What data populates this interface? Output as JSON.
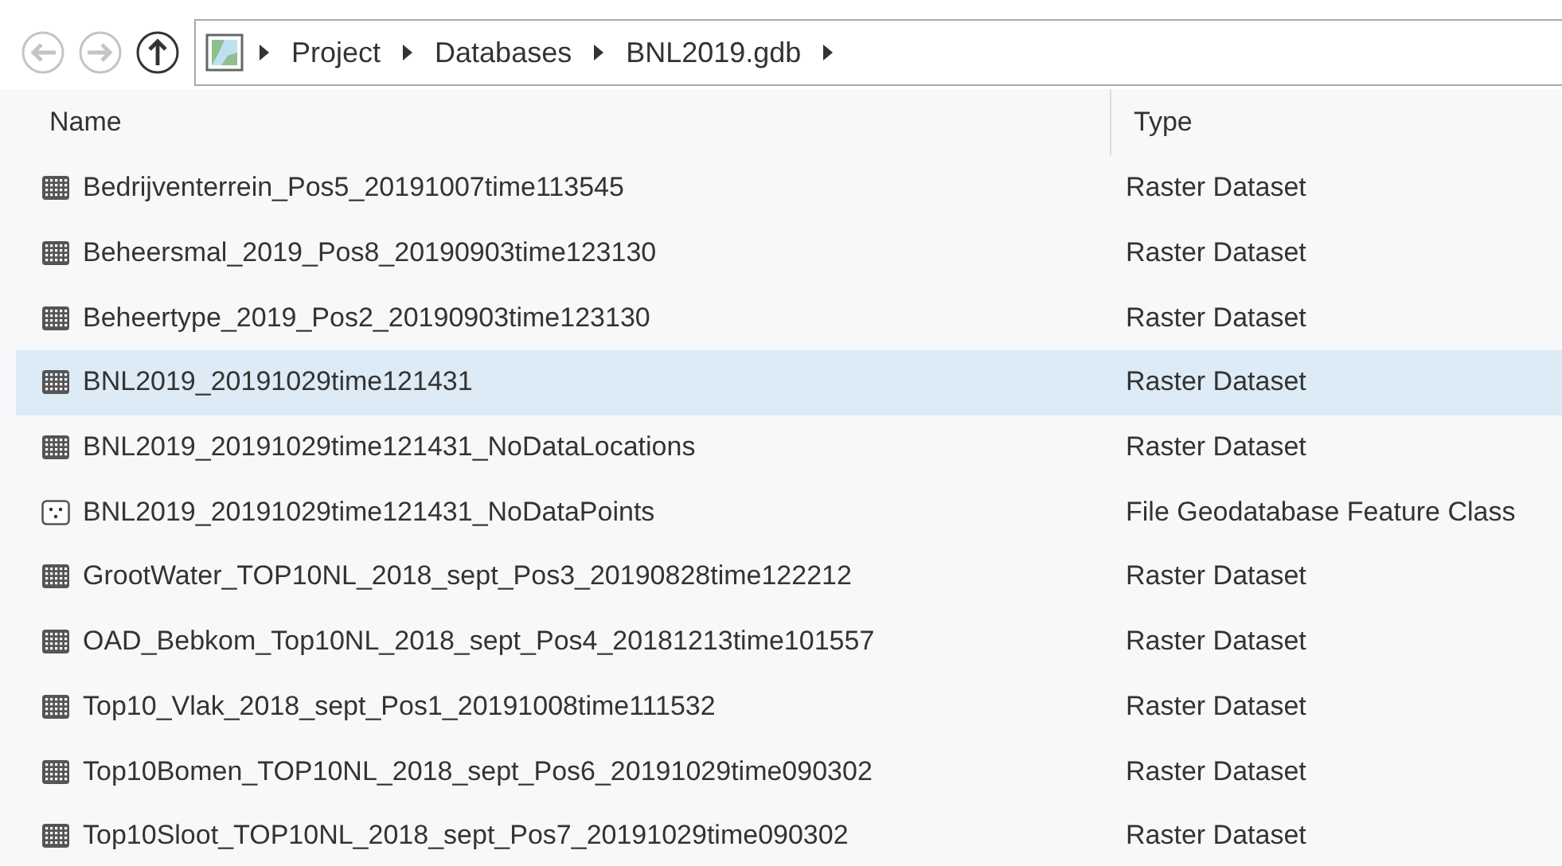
{
  "navigation": {
    "back": {
      "disabled": true
    },
    "forward": {
      "disabled": true
    },
    "up": {
      "disabled": false
    }
  },
  "breadcrumb": [
    "Project",
    "Databases",
    "BNL2019.gdb"
  ],
  "table": {
    "columns": [
      "Name",
      "Type"
    ],
    "rows": [
      {
        "kind": "raster",
        "name": "Bedrijventerrein_Pos5_20191007time113545",
        "type": "Raster Dataset",
        "selected": false
      },
      {
        "kind": "raster",
        "name": "Beheersmal_2019_Pos8_20190903time123130",
        "type": "Raster Dataset",
        "selected": false
      },
      {
        "kind": "raster",
        "name": "Beheertype_2019_Pos2_20190903time123130",
        "type": "Raster Dataset",
        "selected": false
      },
      {
        "kind": "raster",
        "name": "BNL2019_20191029time121431",
        "type": "Raster Dataset",
        "selected": true
      },
      {
        "kind": "raster",
        "name": "BNL2019_20191029time121431_NoDataLocations",
        "type": "Raster Dataset",
        "selected": false
      },
      {
        "kind": "points",
        "name": "BNL2019_20191029time121431_NoDataPoints",
        "type": "File Geodatabase Feature Class",
        "selected": false
      },
      {
        "kind": "raster",
        "name": "GrootWater_TOP10NL_2018_sept_Pos3_20190828time122212",
        "type": "Raster Dataset",
        "selected": false
      },
      {
        "kind": "raster",
        "name": "OAD_Bebkom_Top10NL_2018_sept_Pos4_20181213time101557",
        "type": "Raster Dataset",
        "selected": false
      },
      {
        "kind": "raster",
        "name": "Top10_Vlak_2018_sept_Pos1_20191008time111532",
        "type": "Raster Dataset",
        "selected": false
      },
      {
        "kind": "raster",
        "name": "Top10Bomen_TOP10NL_2018_sept_Pos6_20191029time090302",
        "type": "Raster Dataset",
        "selected": false
      },
      {
        "kind": "raster",
        "name": "Top10Sloot_TOP10NL_2018_sept_Pos7_20191029time090302",
        "type": "Raster Dataset",
        "selected": false
      }
    ]
  }
}
